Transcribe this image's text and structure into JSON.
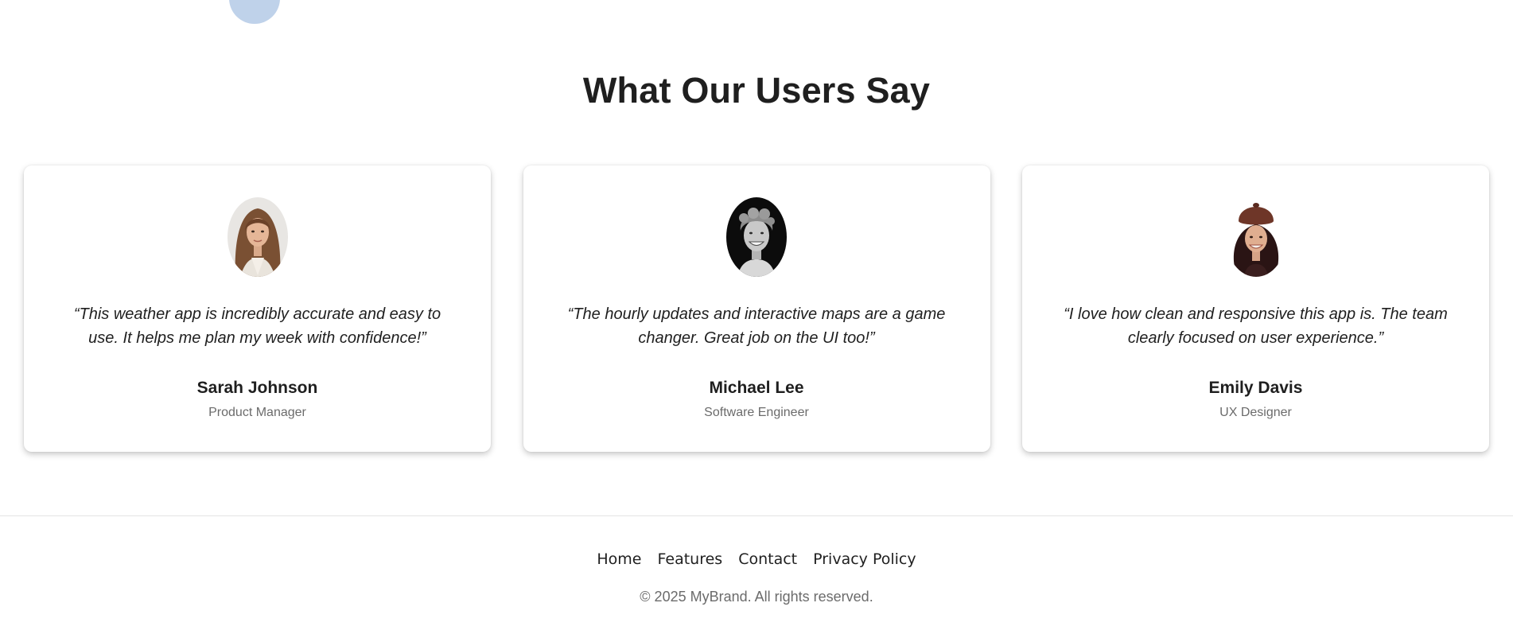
{
  "section": {
    "title": "What Our Users Say"
  },
  "testimonials": [
    {
      "quote": "“This weather app is incredibly accurate and easy to use. It helps me plan my week with confidence!”",
      "name": "Sarah Johnson",
      "role": "Product Manager",
      "avatar": "avatar-photo-woman"
    },
    {
      "quote": "“The hourly updates and interactive maps are a game changer. Great job on the UI too!”",
      "name": "Michael Lee",
      "role": "Software Engineer",
      "avatar": "avatar-photo-man"
    },
    {
      "quote": "“I love how clean and responsive this app is. The team clearly focused on user experience.”",
      "name": "Emily Davis",
      "role": "UX Designer",
      "avatar": "avatar-photo-woman-hat"
    }
  ],
  "footer": {
    "links": [
      "Home",
      "Features",
      "Contact",
      "Privacy Policy"
    ],
    "copyright": "© 2025 MyBrand. All rights reserved."
  },
  "colors": {
    "decor_circle": "#bfd2ea",
    "text_primary": "#1f1f1f",
    "text_secondary": "#6b6b6b",
    "card_background": "#ffffff"
  }
}
